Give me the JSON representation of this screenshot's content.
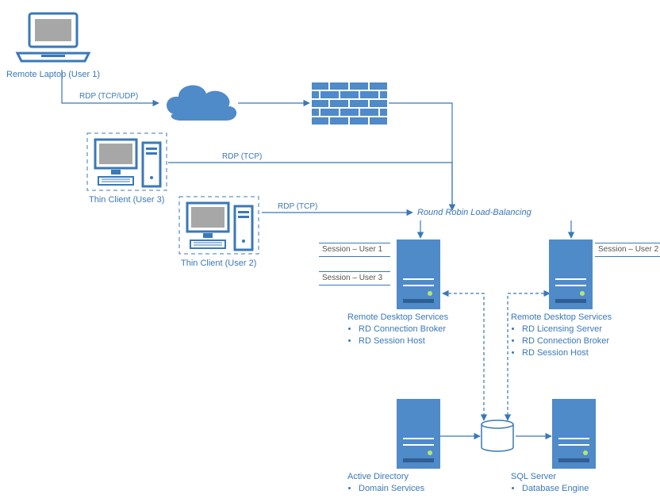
{
  "labels": {
    "laptop": "Remote Laptop (User 1)",
    "thin3": "Thin Client (User 3)",
    "thin2": "Thin Client (User 2)",
    "load_balancing": "Round Robin Load-Balancing"
  },
  "edges": {
    "rdp_tcpudp": "RDP (TCP/UDP)",
    "rdp_tcp_a": "RDP (TCP)",
    "rdp_tcp_b": "RDP (TCP)"
  },
  "sessions": {
    "s1": "Session – User 1",
    "s2": "Session – User 2",
    "s3": "Session – User 3"
  },
  "services": {
    "rds_left": {
      "title": "Remote Desktop Services",
      "items": [
        "RD Connection Broker",
        "RD Session Host"
      ]
    },
    "rds_right": {
      "title": "Remote Desktop Services",
      "items": [
        "RD Licensing Server",
        "RD Connection Broker",
        "RD Session Host"
      ]
    },
    "ad": {
      "title": "Active Directory",
      "items": [
        "Domain Services"
      ]
    },
    "sql": {
      "title": "SQL Server",
      "items": [
        "Database Engine"
      ]
    }
  },
  "chart_data": {
    "type": "diagram",
    "title": "Remote Desktop Services architecture with round-robin load balancing",
    "nodes": [
      {
        "id": "laptop",
        "label": "Remote Laptop (User 1)",
        "type": "laptop"
      },
      {
        "id": "cloud",
        "label": "Cloud / Internet",
        "type": "cloud"
      },
      {
        "id": "firewall",
        "label": "Firewall",
        "type": "firewall"
      },
      {
        "id": "thin3",
        "label": "Thin Client (User 3)",
        "type": "thin-client"
      },
      {
        "id": "thin2",
        "label": "Thin Client (User 2)",
        "type": "thin-client"
      },
      {
        "id": "lb",
        "label": "Round Robin Load-Balancing",
        "type": "load-balancer"
      },
      {
        "id": "rds_left",
        "label": "Remote Desktop Services",
        "type": "server",
        "roles": [
          "RD Connection Broker",
          "RD Session Host"
        ],
        "sessions": [
          "Session – User 1",
          "Session – User 3"
        ]
      },
      {
        "id": "rds_right",
        "label": "Remote Desktop Services",
        "type": "server",
        "roles": [
          "RD Licensing Server",
          "RD Connection Broker",
          "RD Session Host"
        ],
        "sessions": [
          "Session – User 2"
        ]
      },
      {
        "id": "db",
        "label": "Database",
        "type": "database"
      },
      {
        "id": "ad",
        "label": "Active Directory",
        "type": "server",
        "roles": [
          "Domain Services"
        ]
      },
      {
        "id": "sql",
        "label": "SQL Server",
        "type": "server",
        "roles": [
          "Database Engine"
        ]
      }
    ],
    "edges": [
      {
        "from": "laptop",
        "to": "cloud",
        "label": "RDP (TCP/UDP)",
        "style": "solid"
      },
      {
        "from": "cloud",
        "to": "firewall",
        "style": "solid"
      },
      {
        "from": "firewall",
        "to": "lb",
        "style": "solid"
      },
      {
        "from": "thin3",
        "to": "lb",
        "label": "RDP (TCP)",
        "style": "solid"
      },
      {
        "from": "thin2",
        "to": "lb",
        "label": "RDP (TCP)",
        "style": "solid"
      },
      {
        "from": "lb",
        "to": "rds_left",
        "style": "solid"
      },
      {
        "from": "lb",
        "to": "rds_right",
        "style": "solid"
      },
      {
        "from": "rds_left",
        "to": "db",
        "style": "dashed",
        "bidirectional": true
      },
      {
        "from": "rds_right",
        "to": "db",
        "style": "dashed",
        "bidirectional": true
      },
      {
        "from": "ad",
        "to": "db",
        "style": "solid"
      },
      {
        "from": "db",
        "to": "sql",
        "style": "solid"
      }
    ]
  }
}
